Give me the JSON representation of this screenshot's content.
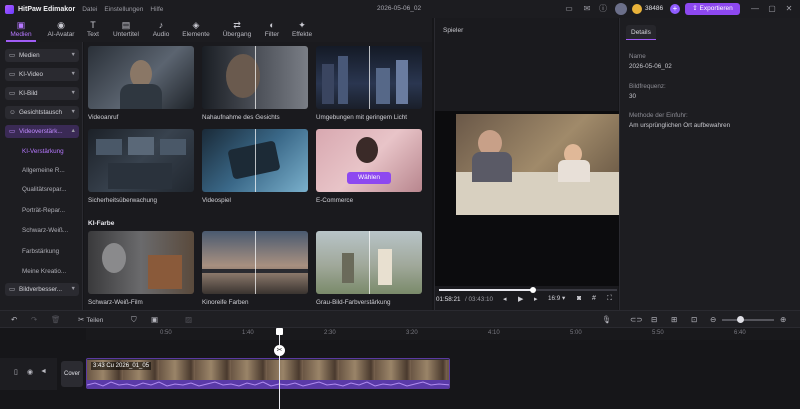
{
  "titlebar": {
    "app_name": "HitPaw Edimakor",
    "menu": [
      "Datei",
      "Einstellungen",
      "Hilfe"
    ],
    "project_title": "2026-05-06_02",
    "coins": "38486",
    "export_label": "Exportieren"
  },
  "toolbar": {
    "tabs": [
      {
        "label": "Medien",
        "icon": "media-icon",
        "glyph": "▣"
      },
      {
        "label": "AI-Avatar",
        "icon": "avatar-icon",
        "glyph": "◉"
      },
      {
        "label": "Text",
        "icon": "text-icon",
        "glyph": "T"
      },
      {
        "label": "Untertitel",
        "icon": "subtitle-icon",
        "glyph": "▤"
      },
      {
        "label": "Audio",
        "icon": "music-icon",
        "glyph": "♪"
      },
      {
        "label": "Elemente",
        "icon": "elements-icon",
        "glyph": "◈"
      },
      {
        "label": "Übergang",
        "icon": "transition-icon",
        "glyph": "⇄"
      },
      {
        "label": "Filter",
        "icon": "filter-icon",
        "glyph": "◐"
      },
      {
        "label": "Effekte",
        "icon": "effects-icon",
        "glyph": "✦"
      }
    ]
  },
  "sidebar": {
    "groups": [
      {
        "label": "Medien",
        "glyph": "▭"
      },
      {
        "label": "KI-Video",
        "glyph": "▭"
      },
      {
        "label": "KI-Bild",
        "glyph": "▭"
      },
      {
        "label": "Gesichtstausch",
        "glyph": "☺"
      },
      {
        "label": "Videoverstärk...",
        "glyph": "▭"
      }
    ],
    "items": [
      "KI-Verstärkung",
      "Allgemeine R...",
      "Qualitätsrepar...",
      "Porträt-Repar...",
      "Schwarz-Weiß...",
      "Farbstärkung",
      "Meine Kreatio..."
    ],
    "bottom_group": {
      "label": "Bildverbesser...",
      "glyph": "▭"
    }
  },
  "content": {
    "row1": [
      "Videoanruf",
      "Nahaufnahme des Gesichts",
      "Umgebungen mit geringem Licht"
    ],
    "row2": [
      "Sicherheitsüberwachung",
      "Videospiel",
      "E-Commerce"
    ],
    "choose_label": "Wählen",
    "section_title": "KI-Farbe",
    "row3": [
      "Schwarz-Weiß-Film",
      "Kinoreife Farben",
      "Grau-Bild-Farbverstärkung"
    ]
  },
  "player": {
    "title": "Spieler",
    "current_time": "01:58:21",
    "total_time": "/ 03:43:10",
    "progress": 0.53,
    "ratio_label": "16:9"
  },
  "details": {
    "tab": "Details",
    "name_label": "Name",
    "name_value": "2026-05-06_02",
    "fps_label": "Bildfrequenz:",
    "fps_value": "30",
    "import_label": "Methode der Einfuhr:",
    "import_value": "Am ursprünglichen Ort aufbewahren"
  },
  "timeline": {
    "split_label": "Teilen",
    "ruler": [
      "0:50",
      "1:40",
      "2:30",
      "3:20",
      "4:10",
      "5:00",
      "5:50",
      "6:40"
    ],
    "cover_label": "Cover",
    "clip_label": "3:43 C\u0000 2026 01 05",
    "clip_label_display": "3:43 Cu  2026_01_05"
  },
  "colors": {
    "accent": "#8d48f0",
    "background": "#161619",
    "panel": "#1d1d21"
  }
}
